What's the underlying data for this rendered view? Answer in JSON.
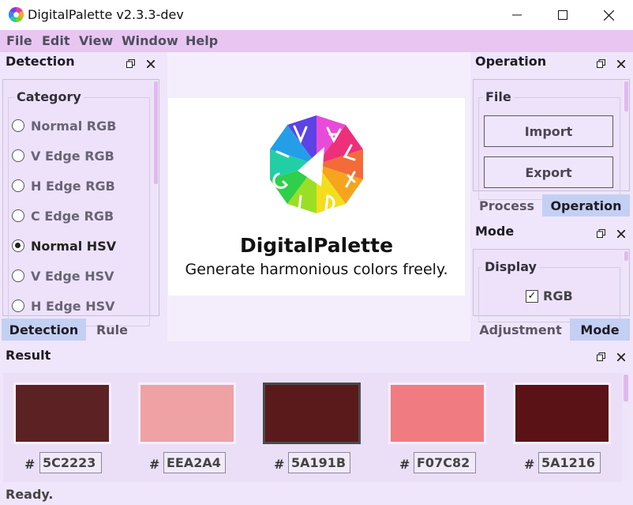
{
  "window": {
    "title": "DigitalPalette v2.3.3-dev",
    "controls": [
      "minimize-icon",
      "maximize-icon",
      "close-icon"
    ]
  },
  "menu": [
    "File",
    "Edit",
    "View",
    "Window",
    "Help"
  ],
  "detection_panel": {
    "title": "Detection",
    "category_label": "Category",
    "options": [
      {
        "label": "Normal RGB",
        "checked": false
      },
      {
        "label": "V Edge RGB",
        "checked": false
      },
      {
        "label": "H Edge RGB",
        "checked": false
      },
      {
        "label": "C Edge RGB",
        "checked": false
      },
      {
        "label": "Normal HSV",
        "checked": true
      },
      {
        "label": "V Edge HSV",
        "checked": false
      },
      {
        "label": "H Edge HSV",
        "checked": false
      }
    ],
    "tabs": [
      {
        "label": "Detection",
        "active": true
      },
      {
        "label": "Rule",
        "active": false
      }
    ]
  },
  "canvas": {
    "logo_letters": "DIGIPALETTE",
    "app_name": "DigitalPalette",
    "tagline": "Generate harmonious colors freely."
  },
  "operation_panel": {
    "title": "Operation",
    "file_label": "File",
    "import_label": "Import",
    "export_label": "Export",
    "tabs": [
      {
        "label": "Process",
        "active": false
      },
      {
        "label": "Operation",
        "active": true
      }
    ]
  },
  "mode_panel": {
    "title": "Mode",
    "display_label": "Display",
    "rgb_label": "RGB",
    "rgb_checked": true,
    "tabs": [
      {
        "label": "Adjustment",
        "active": false
      },
      {
        "label": "Mode",
        "active": true
      }
    ]
  },
  "result_panel": {
    "title": "Result",
    "hash_symbol": "#",
    "swatches": [
      {
        "hex": "5C2223",
        "color": "#5C2223",
        "selected": false
      },
      {
        "hex": "EEA2A4",
        "color": "#EEA2A4",
        "selected": false
      },
      {
        "hex": "5A191B",
        "color": "#5A191B",
        "selected": true
      },
      {
        "hex": "F07C82",
        "color": "#F07C82",
        "selected": false
      },
      {
        "hex": "5A1216",
        "color": "#5A1216",
        "selected": false
      }
    ]
  },
  "status": "Ready.",
  "colors": {
    "background": "#efe6fb",
    "menubar": "#e8c6f1",
    "active_tab": "#c4d0f3",
    "canvas_background": "#f4eefc"
  }
}
